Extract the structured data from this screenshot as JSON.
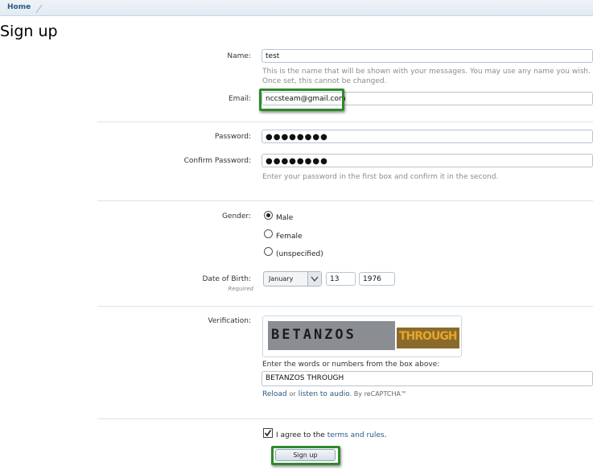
{
  "breadcrumb": {
    "home": "Home"
  },
  "page_title": "Sign up",
  "form": {
    "name": {
      "label": "Name:",
      "value": "test",
      "hint": "This is the name that will be shown with your messages. You may use any name you wish. Once set, this cannot be changed."
    },
    "email": {
      "label": "Email:",
      "value": "nccsteam@gmail.com"
    },
    "password": {
      "label": "Password:",
      "value": "●●●●●●●●"
    },
    "confirm_password": {
      "label": "Confirm Password:",
      "value": "●●●●●●●●",
      "hint": "Enter your password in the first box and confirm it in the second."
    },
    "gender": {
      "label": "Gender:",
      "options": [
        "Male",
        "Female",
        "(unspecified)"
      ],
      "selected": "Male"
    },
    "dob": {
      "label": "Date of Birth:",
      "required": "Required",
      "month": "January",
      "day": "13",
      "year": "1976"
    },
    "verification": {
      "label": "Verification:",
      "captcha_word1": "BETANZOS",
      "captcha_word2": "THROUGH",
      "instructions": "Enter the words or numbers from the box above:",
      "value": "BETANZOS THROUGH",
      "reload": "Reload",
      "or": "or",
      "audio": "listen to audio",
      "by": ". By reCAPTCHA™"
    },
    "agree": {
      "prefix": "I agree to the",
      "link": "terms and rules",
      "suffix": ".",
      "checked": true
    },
    "submit": "Sign up"
  },
  "colors": {
    "highlight": "#2f8a2b",
    "link": "#2a5a85"
  }
}
